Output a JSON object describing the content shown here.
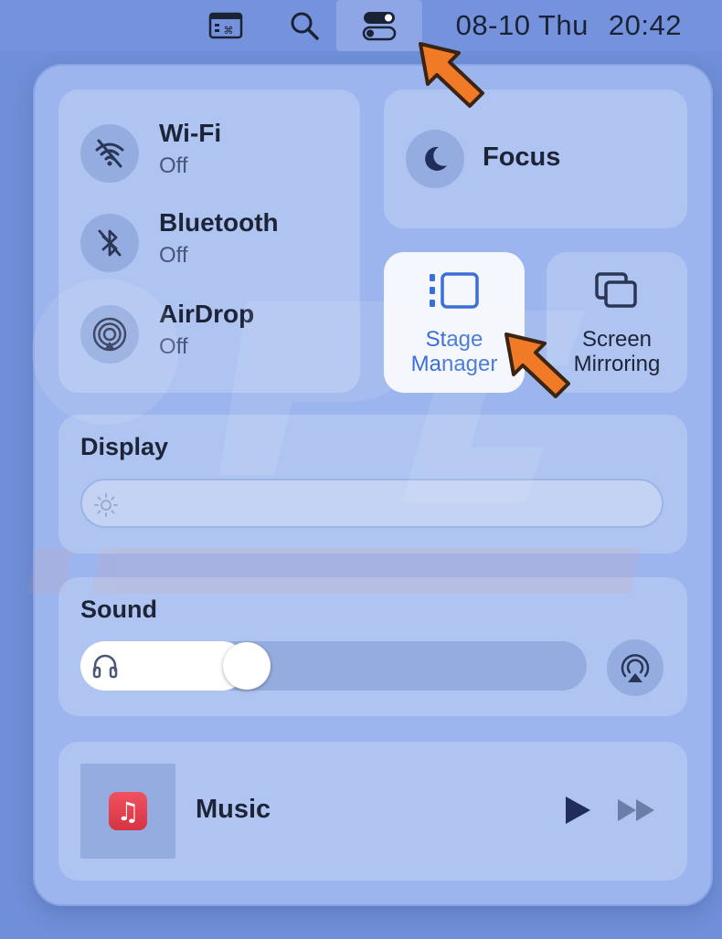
{
  "menubar": {
    "date": "08-10 Thu",
    "time": "20:42",
    "icons": [
      "keyboard-viewer-icon",
      "search-icon",
      "control-center-icon"
    ]
  },
  "connectivity": [
    {
      "name": "Wi-Fi",
      "status": "Off",
      "icon": "wifi-off-icon"
    },
    {
      "name": "Bluetooth",
      "status": "Off",
      "icon": "bluetooth-off-icon"
    },
    {
      "name": "AirDrop",
      "status": "Off",
      "icon": "airdrop-icon"
    }
  ],
  "focus": {
    "label": "Focus",
    "icon": "moon-icon"
  },
  "stage_manager": {
    "line1": "Stage",
    "line2": "Manager",
    "active": true
  },
  "screen_mirroring": {
    "line1": "Screen",
    "line2": "Mirroring"
  },
  "display": {
    "title": "Display",
    "brightness": 0.0
  },
  "sound": {
    "title": "Sound",
    "volume": 0.28
  },
  "now_playing": {
    "label": "Music",
    "app_icon": "♫"
  },
  "colors": {
    "accent": "#3b6fd6",
    "annotation_arrow": "#f07a26",
    "panel_bg": "#9cb5ee",
    "tile_bg": "#afc4f1"
  }
}
